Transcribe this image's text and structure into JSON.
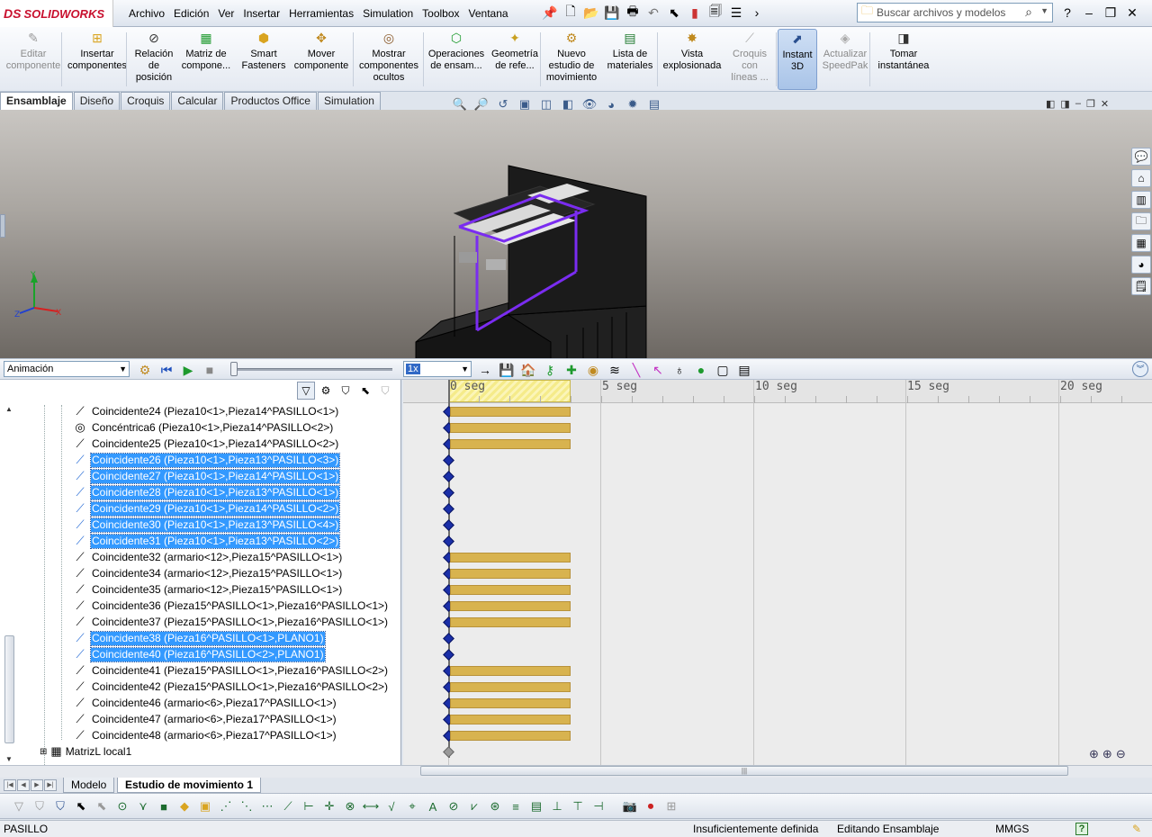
{
  "app": {
    "brand": "SOLIDWORKS",
    "brand_prefix": "DS"
  },
  "menu": [
    "Archivo",
    "Edición",
    "Ver",
    "Insertar",
    "Herramientas",
    "Simulation",
    "Toolbox",
    "Ventana"
  ],
  "search": {
    "placeholder": "Buscar archivos y modelos"
  },
  "commands": [
    {
      "label": "Editar componente",
      "disabled": true,
      "icon": "edit-component-icon"
    },
    {
      "label": "Insertar componentes",
      "icon": "insert-components-icon"
    },
    {
      "label": "Relación de posición",
      "icon": "mate-icon"
    },
    {
      "label": "Matriz de compone...",
      "icon": "pattern-icon"
    },
    {
      "label": "Smart Fasteners",
      "icon": "fastener-icon"
    },
    {
      "label": "Mover componente",
      "icon": "move-component-icon"
    },
    {
      "label": "Mostrar componentes ocultos",
      "icon": "show-hidden-icon"
    },
    {
      "label": "Operaciones de ensam...",
      "icon": "assembly-features-icon"
    },
    {
      "label": "Geometría de refe...",
      "icon": "reference-geometry-icon"
    },
    {
      "label": "Nuevo estudio de movimiento",
      "icon": "new-motion-study-icon"
    },
    {
      "label": "Lista de materiales",
      "icon": "bom-icon"
    },
    {
      "label": "Vista explosionada",
      "icon": "exploded-view-icon"
    },
    {
      "label": "Croquis con líneas ...",
      "disabled": true,
      "icon": "sketch-lines-icon"
    },
    {
      "label": "Instant 3D",
      "active": true,
      "icon": "instant3d-icon"
    },
    {
      "label": "Actualizar SpeedPak",
      "disabled": true,
      "icon": "speedpak-icon"
    },
    {
      "label": "Tomar instantánea",
      "icon": "snapshot-icon"
    }
  ],
  "tabs": [
    "Ensamblaje",
    "Diseño",
    "Croquis",
    "Calcular",
    "Productos Office",
    "Simulation"
  ],
  "motion": {
    "study_type": "Animación",
    "speed": "1x",
    "time_ticks": [
      "0 seg",
      "5 seg",
      "10 seg",
      "15 seg",
      "20 seg"
    ]
  },
  "tree_rows": [
    {
      "label": "Coincidente24 (Pieza10<1>,Pieza14^PASILLO<1>)",
      "type": "coincident",
      "selected": false,
      "bar": true
    },
    {
      "label": "Concéntrica6 (Pieza10<1>,Pieza14^PASILLO<2>)",
      "type": "concentric",
      "selected": false,
      "bar": true
    },
    {
      "label": "Coincidente25 (Pieza10<1>,Pieza14^PASILLO<2>)",
      "type": "coincident",
      "selected": false,
      "bar": true
    },
    {
      "label": "Coincidente26 (Pieza10<1>,Pieza13^PASILLO<3>)",
      "type": "coincident",
      "selected": true,
      "bar": false
    },
    {
      "label": "Coincidente27 (Pieza10<1>,Pieza14^PASILLO<1>)",
      "type": "coincident",
      "selected": true,
      "bar": false
    },
    {
      "label": "Coincidente28 (Pieza10<1>,Pieza13^PASILLO<1>)",
      "type": "coincident",
      "selected": true,
      "bar": false
    },
    {
      "label": "Coincidente29 (Pieza10<1>,Pieza14^PASILLO<2>)",
      "type": "coincident",
      "selected": true,
      "bar": false
    },
    {
      "label": "Coincidente30 (Pieza10<1>,Pieza13^PASILLO<4>)",
      "type": "coincident",
      "selected": true,
      "bar": false
    },
    {
      "label": "Coincidente31 (Pieza10<1>,Pieza13^PASILLO<2>)",
      "type": "coincident",
      "selected": true,
      "bar": false
    },
    {
      "label": "Coincidente32 (armario<12>,Pieza15^PASILLO<1>)",
      "type": "coincident",
      "selected": false,
      "bar": true
    },
    {
      "label": "Coincidente34 (armario<12>,Pieza15^PASILLO<1>)",
      "type": "coincident",
      "selected": false,
      "bar": true
    },
    {
      "label": "Coincidente35 (armario<12>,Pieza15^PASILLO<1>)",
      "type": "coincident",
      "selected": false,
      "bar": true
    },
    {
      "label": "Coincidente36 (Pieza15^PASILLO<1>,Pieza16^PASILLO<1>)",
      "type": "coincident",
      "selected": false,
      "bar": true
    },
    {
      "label": "Coincidente37 (Pieza15^PASILLO<1>,Pieza16^PASILLO<1>)",
      "type": "coincident",
      "selected": false,
      "bar": true
    },
    {
      "label": "Coincidente38 (Pieza16^PASILLO<1>,PLANO1)",
      "type": "coincident",
      "selected": true,
      "bar": false
    },
    {
      "label": "Coincidente40 (Pieza16^PASILLO<2>,PLANO1)",
      "type": "coincident",
      "selected": true,
      "bar": false
    },
    {
      "label": "Coincidente41 (Pieza15^PASILLO<1>,Pieza16^PASILLO<2>)",
      "type": "coincident",
      "selected": false,
      "bar": true
    },
    {
      "label": "Coincidente42 (Pieza15^PASILLO<1>,Pieza16^PASILLO<2>)",
      "type": "coincident",
      "selected": false,
      "bar": true
    },
    {
      "label": "Coincidente46 (armario<6>,Pieza17^PASILLO<1>)",
      "type": "coincident",
      "selected": false,
      "bar": true
    },
    {
      "label": "Coincidente47 (armario<6>,Pieza17^PASILLO<1>)",
      "type": "coincident",
      "selected": false,
      "bar": true
    },
    {
      "label": "Coincidente48 (armario<6>,Pieza17^PASILLO<1>)",
      "type": "coincident",
      "selected": false,
      "bar": true
    }
  ],
  "tree_footer": "MatrizL local1",
  "bottom_tabs": [
    "Modelo",
    "Estudio de movimiento 1"
  ],
  "status": {
    "document": "PASILLO",
    "definition": "Insuficientemente definida",
    "mode": "Editando Ensamblaje",
    "units": "MMGS",
    "help": "?"
  },
  "colors": {
    "selection": "#3399ff",
    "timeline_bar": "#d8b34f",
    "key_point": "#1a2fa8",
    "brand": "#c8102e"
  }
}
